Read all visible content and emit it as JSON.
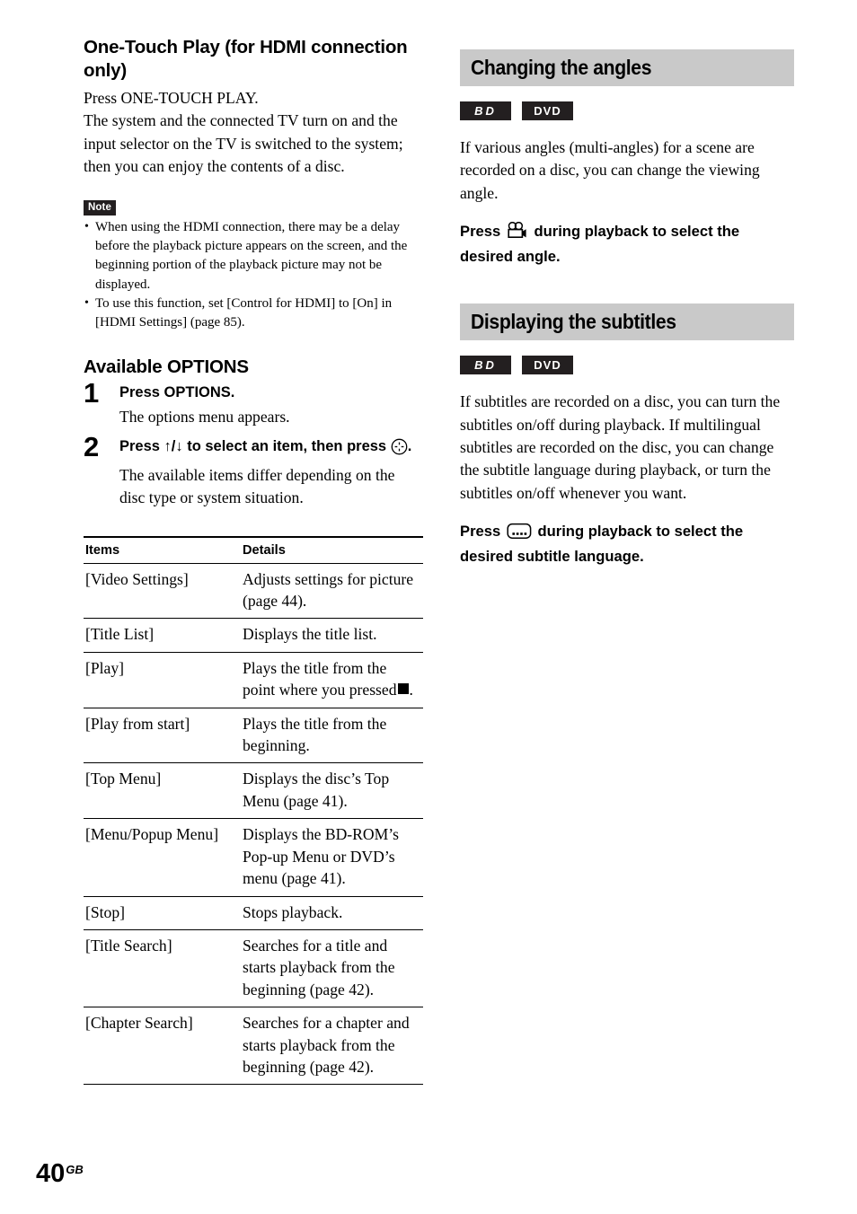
{
  "page": {
    "number": "40",
    "region_suffix": "GB"
  },
  "left_column": {
    "heading": "One-Touch Play (for HDMI connection only)",
    "paragraphs": [
      "Press ONE-TOUCH PLAY.",
      "The system and the connected TV turn on and the input selector on the TV is switched to the system; then you can enjoy the contents of a disc."
    ],
    "note": {
      "tag": "Note",
      "items": [
        "When using the HDMI connection, there may be a delay before the playback picture appears on the screen, and the beginning portion of the playback picture may not be displayed.",
        "To use this function, set [Control for HDMI] to [On] in [HDMI Settings] (page 85)."
      ]
    },
    "options_heading": "Available OPTIONS",
    "steps": [
      {
        "number": "1",
        "title": "Press OPTIONS.",
        "description": "The options menu appears."
      },
      {
        "number": "2",
        "title_before_icon": "Press ↑/↓ to select an item, then press",
        "title_after_icon": ".",
        "icon": "enter-button-icon",
        "description": "The available items differ depending on the disc type or system situation."
      }
    ],
    "table": {
      "headers": [
        "Items",
        "Details"
      ],
      "rows": [
        {
          "item": "[Video Settings]",
          "detail": "Adjusts settings for picture (page 44)."
        },
        {
          "item": "[Title List]",
          "detail": "Displays the title list."
        },
        {
          "item": "[Play]",
          "detail_before_icon": "Plays the title from the point where you pressed",
          "detail_icon": "stop-button-icon",
          "detail_after_icon": "."
        },
        {
          "item": "[Play from start]",
          "detail": "Plays the title from the beginning."
        },
        {
          "item": "[Top Menu]",
          "detail": "Displays the disc’s Top Menu (page 41)."
        },
        {
          "item": "[Menu/Popup Menu]",
          "detail": "Displays the BD-ROM’s Pop-up Menu or DVD’s menu (page 41)."
        },
        {
          "item": "[Stop]",
          "detail": "Stops playback."
        },
        {
          "item": "[Title Search]",
          "detail": "Searches for a title and starts playback from the beginning (page 42)."
        },
        {
          "item": "[Chapter Search]",
          "detail": "Searches for a chapter and starts playback from the beginning (page 42)."
        }
      ]
    }
  },
  "right_column": {
    "sections": [
      {
        "title": "Changing the angles",
        "badges": [
          "BD",
          "DVD"
        ],
        "body": "If various angles (multi-angles) for a scene are recorded on a disc, you can change the viewing angle.",
        "press_before_icon": "Press",
        "press_icon": "angle-camera-icon",
        "press_after_icon": "during playback to select the desired angle."
      },
      {
        "title": "Displaying the subtitles",
        "badges": [
          "BD",
          "DVD"
        ],
        "body": "If subtitles are recorded on a disc, you can turn the subtitles on/off during playback. If multilingual subtitles are recorded on the disc, you can change the subtitle language during playback, or turn the subtitles on/off whenever you want.",
        "press_before_icon": "Press",
        "press_icon": "subtitle-icon",
        "press_after_icon": "during playback to select the desired subtitle language."
      }
    ]
  },
  "colors": {
    "section_bar": "#c9c9c9",
    "badge_background": "#231f20",
    "text": "#000000"
  }
}
